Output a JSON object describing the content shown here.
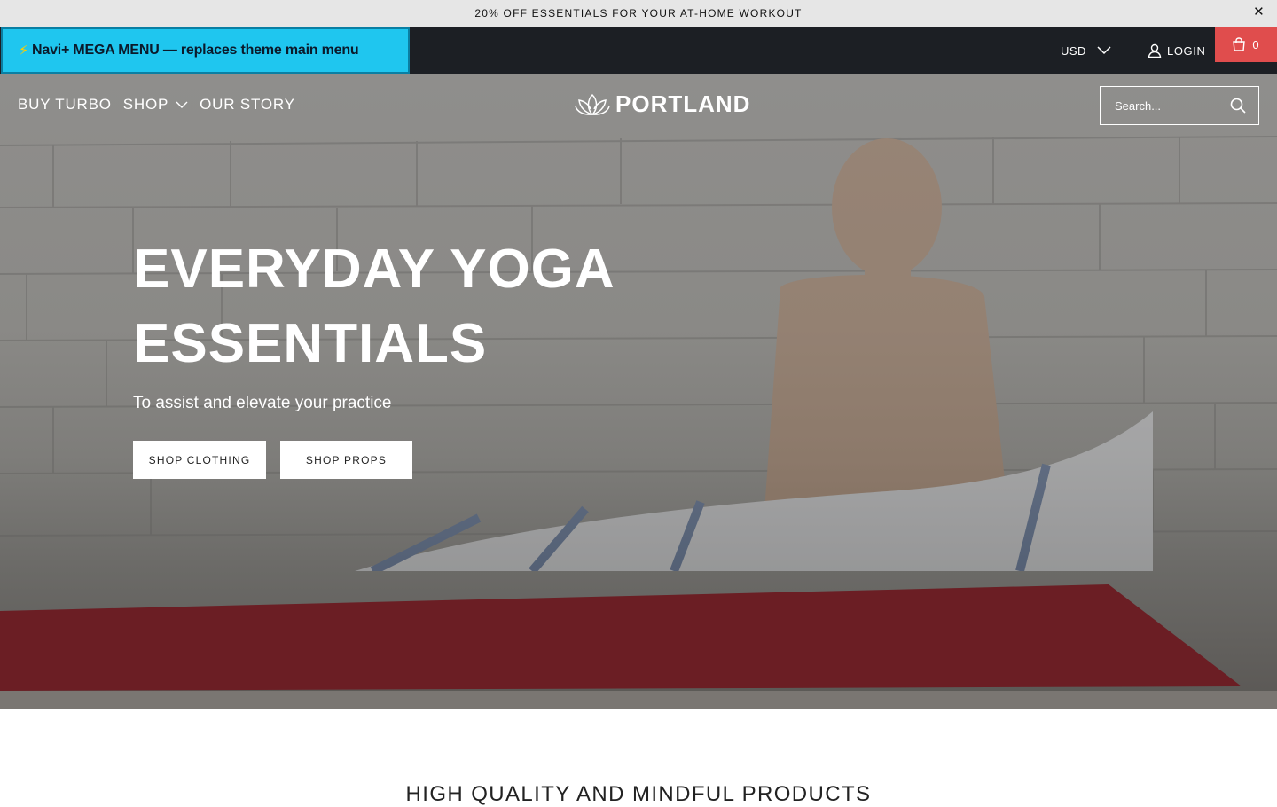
{
  "announcement": {
    "text": "20% OFF ESSENTIALS FOR YOUR AT-HOME WORKOUT",
    "close_icon": "close-icon"
  },
  "topbar": {
    "mega_banner_bolt": "⚡",
    "mega_banner": "Navi+ MEGA MENU — replaces theme main menu",
    "currency": "USD",
    "login": "LOGIN",
    "cart_count": "0",
    "cart_color": "#e04d4d",
    "bar_color": "#1c1f24",
    "banner_color": "#1fc6ef"
  },
  "nav": {
    "items": [
      {
        "label": "BUY TURBO"
      },
      {
        "label": "SHOP"
      },
      {
        "label": "OUR STORY"
      }
    ]
  },
  "logo": {
    "text": "PORTLAND",
    "icon": "lotus-icon"
  },
  "search": {
    "placeholder": "Search..."
  },
  "hero": {
    "headline_line1": "EVERYDAY YOGA",
    "headline_line2": "ESSENTIALS",
    "subhead": "To assist and elevate your practice",
    "cta_primary": "SHOP CLOTHING",
    "cta_secondary": "SHOP PROPS"
  },
  "section": {
    "title": "HIGH QUALITY AND MINDFUL PRODUCTS"
  }
}
